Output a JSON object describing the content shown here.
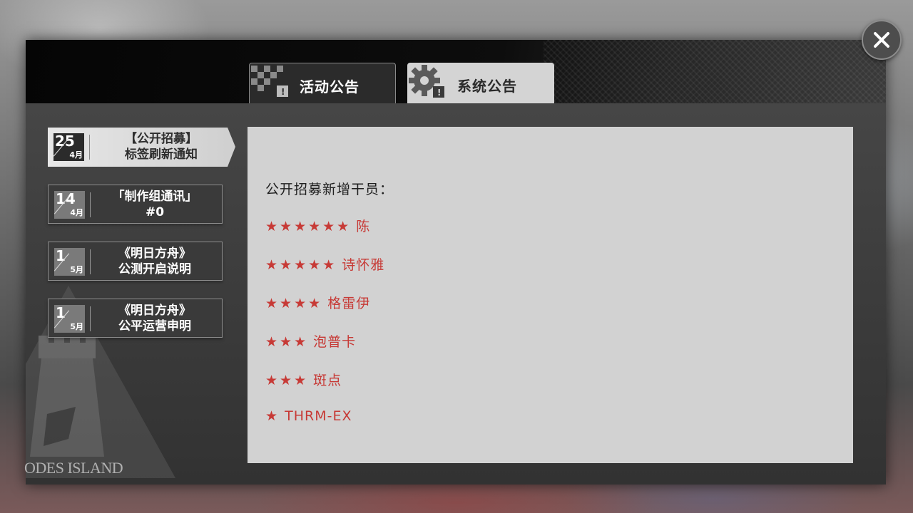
{
  "header": {
    "tabs": [
      {
        "label": "活动公告",
        "active": false,
        "icon": "checkered-flag-icon"
      },
      {
        "label": "系统公告",
        "active": true,
        "icon": "gear-icon"
      }
    ]
  },
  "notices": [
    {
      "day": "25",
      "month": "4月",
      "title": "【公开招募】\n标签刷新通知",
      "active": true
    },
    {
      "day": "14",
      "month": "4月",
      "title": "「制作组通讯」\n#0",
      "active": false
    },
    {
      "day": "1",
      "month": "5月",
      "title": "《明日方舟》\n公测开启说明",
      "active": false
    },
    {
      "day": "1",
      "month": "5月",
      "title": "《明日方舟》\n公平运营申明",
      "active": false
    }
  ],
  "content": {
    "heading": "公开招募新增干员：",
    "operators": [
      {
        "stars": "★★★★★★",
        "name": "陈"
      },
      {
        "stars": "★★★★★",
        "name": "诗怀雅"
      },
      {
        "stars": "★★★★",
        "name": "格雷伊"
      },
      {
        "stars": "★★★",
        "name": "泡普卡"
      },
      {
        "stars": "★★★",
        "name": "斑点"
      },
      {
        "stars": "★",
        "name": "THRM-EX"
      }
    ]
  },
  "emblem": {
    "text": "ODES ISLAND"
  },
  "colors": {
    "accent_red": "#c73a36",
    "panel": "#3b3b3b",
    "content_bg": "#d2d2d2"
  }
}
